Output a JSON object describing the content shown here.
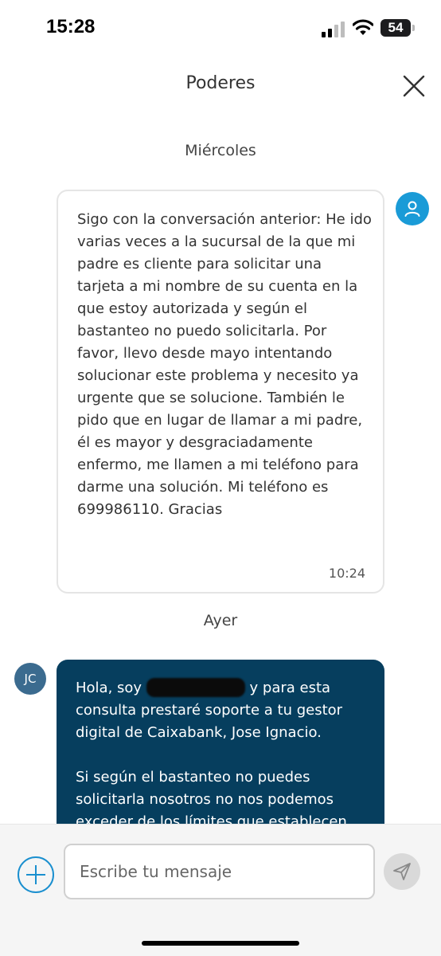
{
  "status_bar": {
    "time": "15:28",
    "battery_level": "54",
    "icons": [
      "signal-icon",
      "wifi-icon",
      "battery-icon"
    ]
  },
  "header": {
    "title": "Poderes",
    "close_icon": "close-icon"
  },
  "conversation": {
    "groups": [
      {
        "day_label": "Miércoles",
        "message": {
          "sender": "user",
          "avatar_icon": "user-icon",
          "text": "Sigo con la conversación anterior: He ido varias veces a la sucursal de la que mi padre es cliente para solicitar una tarjeta a mi nombre de su cuenta en la que estoy autorizada y según el bastanteo no puedo solicitarla. Por favor, llevo desde mayo intentando solucionar este problema y necesito ya urgente que se solucione. También le pido que en lugar de llamar a mi padre, él es mayor y desgraciadamente enfermo, me llamen a mi teléfono para darme una solución. Mi teléfono es 699986110. Gracias",
          "time": "10:24"
        }
      },
      {
        "day_label": "Ayer",
        "message": {
          "sender": "agent",
          "avatar_initials": "JC",
          "text_before_redaction": "Hola, soy ",
          "text_after_redaction": " y para esta consulta prestaré soporte a tu gestor digital de Caixabank, Jose Ignacio.\n\nSi según el bastanteo no puedes solicitarla nosotros no nos podemos exceder de los límites que establecen"
        }
      }
    ]
  },
  "composer": {
    "placeholder": "Escribe tu mensaje",
    "add_icon": "plus-circle-icon",
    "send_icon": "send-icon"
  },
  "colors": {
    "accent": "#1a9bd7",
    "agent_bubble": "#063e5e",
    "agent_avatar": "#3b6b8f"
  }
}
